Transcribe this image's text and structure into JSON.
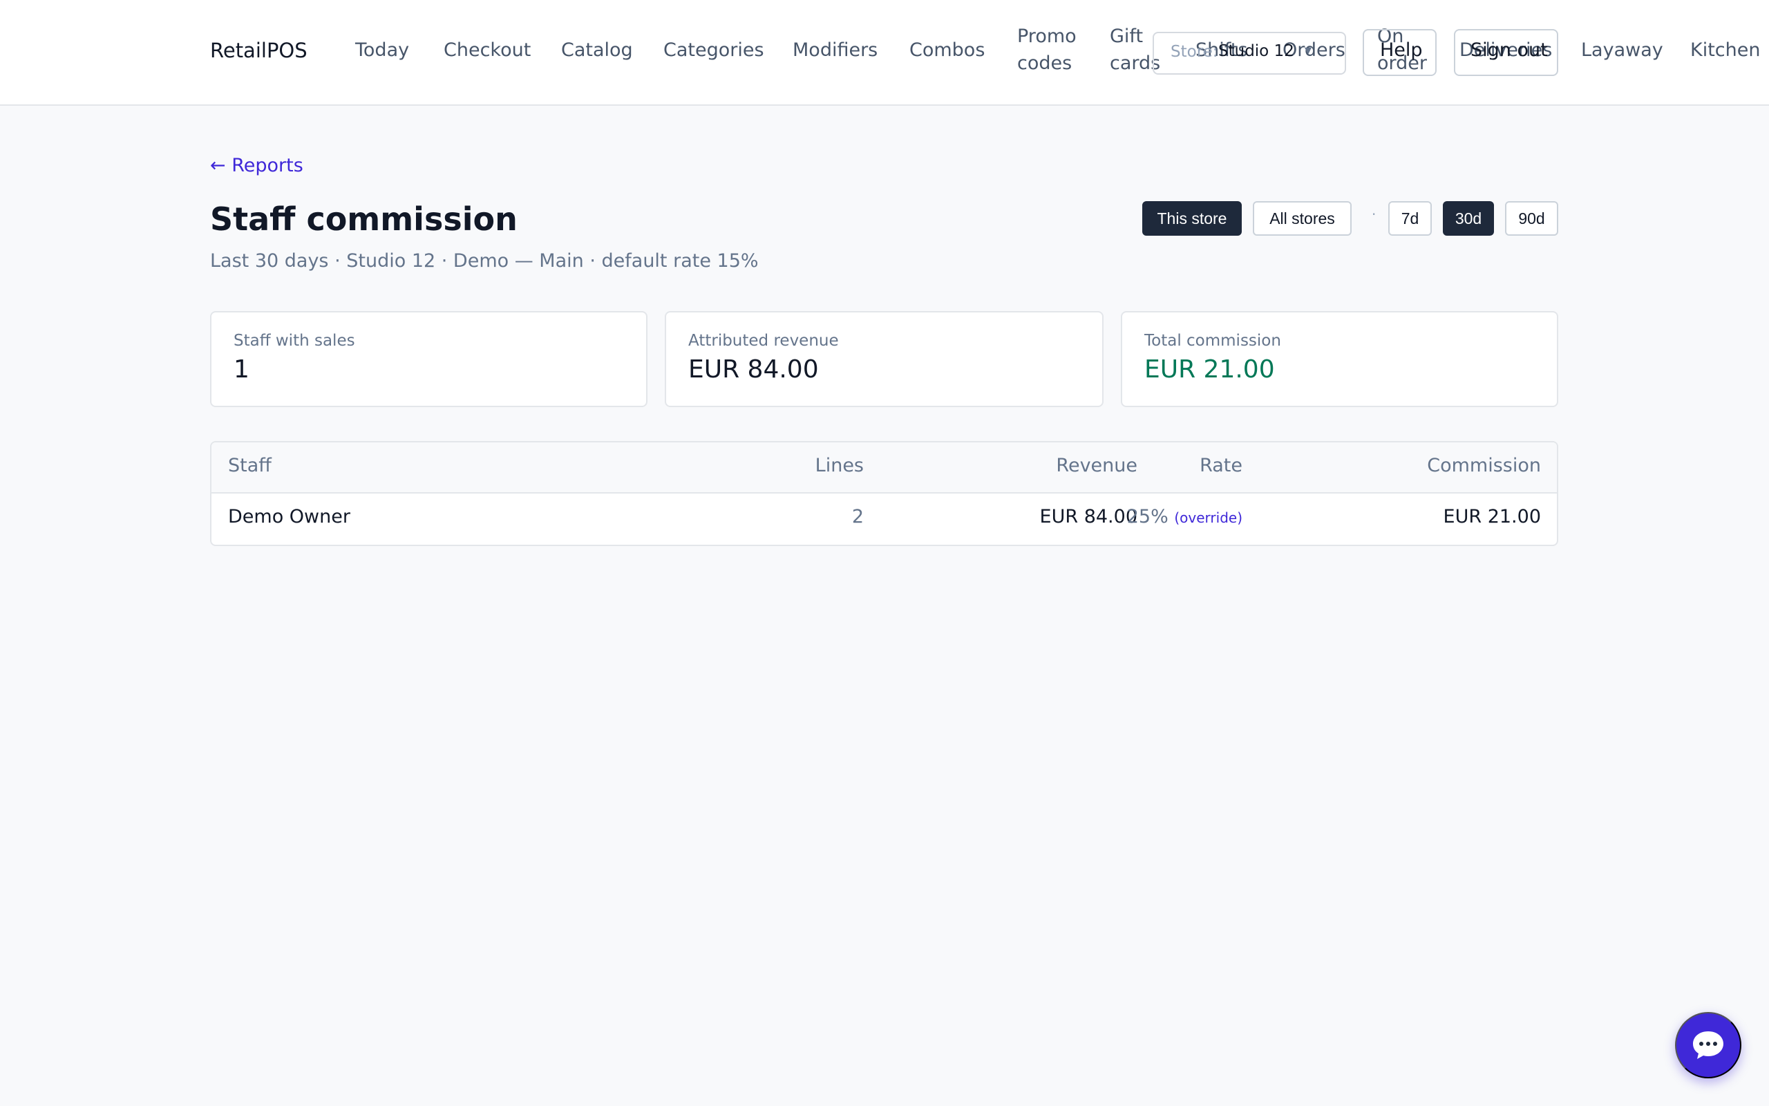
{
  "app": {
    "brand": "RetailPOS"
  },
  "nav": {
    "today": "Today",
    "checkout": "Checkout",
    "catalog": "Catalog",
    "categories": "Categories",
    "modifiers": "Modifiers",
    "combos": "Combos",
    "promo_codes": "Promo codes",
    "gift_cards": "Gift cards",
    "shifts": "Shifts",
    "orders": "Orders",
    "on_order": "On order",
    "deliveries": "Deliveries",
    "layaway": "Layaway",
    "kitchen": "Kitchen"
  },
  "header": {
    "store_label": "Store:",
    "store_value": "Studio 12",
    "help": "Help",
    "sign_out": "Sign out"
  },
  "page": {
    "back_link": "← Reports",
    "title": "Staff commission",
    "subtitle": "Last 30 days · Studio 12 · Demo — Main · default rate 15%"
  },
  "filters": {
    "scope": [
      "This store",
      "All stores"
    ],
    "scope_selected": "This store",
    "separator": "·",
    "ranges": [
      "7d",
      "30d",
      "90d"
    ],
    "range_selected": "30d"
  },
  "stats": [
    {
      "label": "Staff with sales",
      "value": "1"
    },
    {
      "label": "Attributed revenue",
      "value": "EUR 84.00"
    },
    {
      "label": "Total commission",
      "value": "EUR 21.00"
    }
  ],
  "table": {
    "columns": [
      "Staff",
      "Lines",
      "Revenue",
      "Rate",
      "Commission"
    ],
    "rows": [
      {
        "staff": "Demo Owner",
        "lines": "2",
        "revenue": "EUR 84.00",
        "rate": "25%",
        "rate_note": "(override)",
        "commission": "EUR 21.00"
      }
    ]
  },
  "colors": {
    "accent": "#3f28d8",
    "dark": "#1e293b",
    "positive": "#047857"
  },
  "chat": {
    "icon": "chat-bubble-icon"
  }
}
